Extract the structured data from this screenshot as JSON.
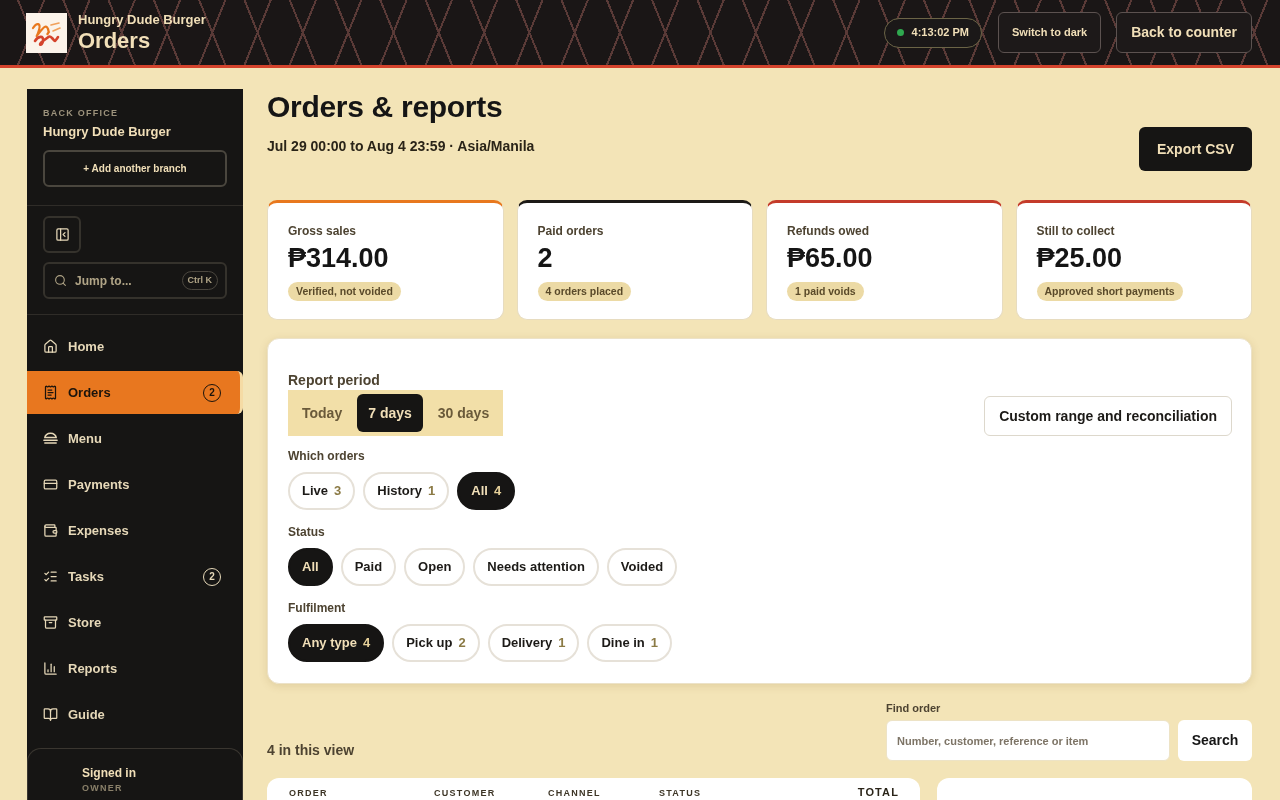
{
  "header": {
    "brand": "Hungry Dude Burger",
    "title": "Orders",
    "clock": "4:13:02 PM",
    "buttons": [
      "Switch to dark",
      "Back to counter"
    ]
  },
  "sidebar": {
    "eyebrow": "BACK OFFICE",
    "branch": "Hungry Dude Burger",
    "add_branch": "+ Add another branch",
    "search": {
      "placeholder": "Jump to...",
      "shortcut": "Ctrl K"
    },
    "items": [
      {
        "label": "Home",
        "selected": false
      },
      {
        "label": "Orders",
        "selected": true,
        "badge": "2"
      },
      {
        "label": "Menu",
        "selected": false
      },
      {
        "label": "Payments",
        "selected": false
      },
      {
        "label": "Expenses",
        "selected": false
      },
      {
        "label": "Tasks",
        "selected": false,
        "badge": "2"
      },
      {
        "label": "Store",
        "selected": false
      },
      {
        "label": "Reports",
        "selected": false
      },
      {
        "label": "Guide",
        "selected": false
      }
    ],
    "account": {
      "status": "Signed in",
      "role": "OWNER"
    }
  },
  "page": {
    "title": "Orders & reports",
    "subtitle": "Jul 29 00:00 to Aug 4 23:59 · Asia/Manila",
    "export_button": "Export CSV"
  },
  "kpis": [
    {
      "label": "Gross sales",
      "value": "₱314.00",
      "note": "Verified, not voided",
      "color": "#e8781e"
    },
    {
      "label": "Paid orders",
      "value": "2",
      "note": "4 orders placed",
      "color": "#1c1a17"
    },
    {
      "label": "Refunds owed",
      "value": "₱65.00",
      "note": "1 paid voids",
      "color": "#c43b2a"
    },
    {
      "label": "Still to collect",
      "value": "₱25.00",
      "note": "Approved short payments",
      "color": "#c43b2a"
    }
  ],
  "filters": {
    "period": {
      "label": "Report period",
      "options": [
        {
          "label": "Today",
          "selected": false
        },
        {
          "label": "7 days",
          "selected": true
        },
        {
          "label": "30 days",
          "selected": false
        }
      ]
    },
    "custom_button": "Custom range and reconciliation",
    "groups": [
      {
        "label": "Which orders",
        "options": [
          {
            "label": "Live",
            "count": "3",
            "selected": false
          },
          {
            "label": "History",
            "count": "1",
            "selected": false
          },
          {
            "label": "All",
            "count": "4",
            "selected": true
          }
        ]
      },
      {
        "label": "Status",
        "options": [
          {
            "label": "All",
            "selected": true
          },
          {
            "label": "Paid",
            "selected": false
          },
          {
            "label": "Open",
            "selected": false
          },
          {
            "label": "Needs attention",
            "selected": false
          },
          {
            "label": "Voided",
            "selected": false
          }
        ]
      },
      {
        "label": "Fulfilment",
        "options": [
          {
            "label": "Any type",
            "count": "4",
            "selected": true
          },
          {
            "label": "Pick up",
            "count": "2",
            "selected": false
          },
          {
            "label": "Delivery",
            "count": "1",
            "selected": false
          },
          {
            "label": "Dine in",
            "count": "1",
            "selected": false
          }
        ]
      }
    ]
  },
  "results": {
    "summary": "4 in this view",
    "find": {
      "label": "Find order",
      "placeholder": "Number, customer, reference or item",
      "button": "Search"
    }
  },
  "table": {
    "columns": [
      "ORDER",
      "CUSTOMER",
      "CHANNEL",
      "STATUS",
      "TOTAL"
    ]
  }
}
